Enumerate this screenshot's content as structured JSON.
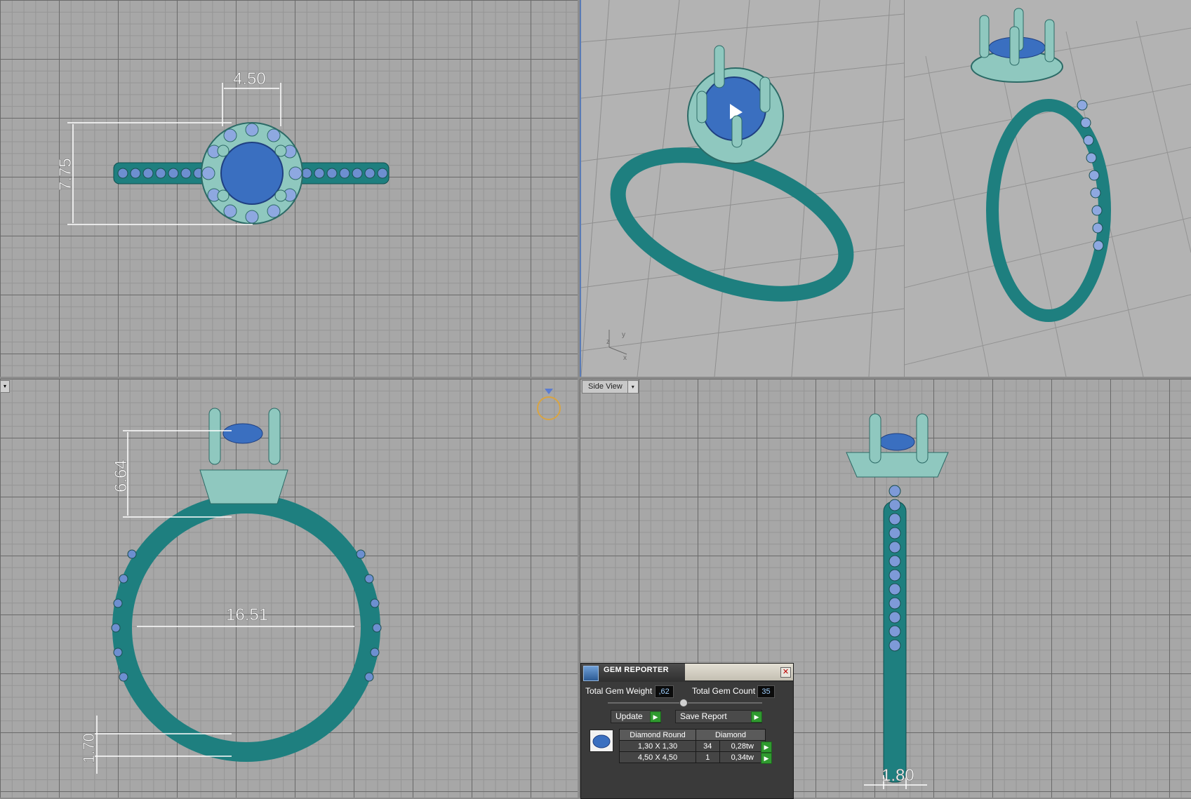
{
  "viewports": {
    "top": {
      "dim_width": "4.50",
      "dim_height": "7.75"
    },
    "front": {
      "dim_head": "6.64",
      "dim_inner": "16.51",
      "dim_shank": "1.70"
    },
    "side": {
      "label": "Side View",
      "dim_width": "1.80"
    }
  },
  "axes": {
    "x": "x",
    "y": "y",
    "z": "z"
  },
  "colors": {
    "metal": "#1e7f7f",
    "metal_light": "#8fc8bf",
    "stone": "#3a6fc0",
    "grid_bg": "#a7a7a7",
    "panel_bg": "#3a3a3a",
    "accent_green": "#2f9a2f"
  },
  "gem_reporter": {
    "title": "GEM REPORTER",
    "total_weight_label": "Total Gem Weight",
    "total_weight_value": ",62",
    "total_count_label": "Total Gem Count",
    "total_count_value": "35",
    "update_label": "Update",
    "save_label": "Save Report",
    "table": {
      "headers": [
        "Diamond Round",
        "Diamond"
      ],
      "rows": [
        {
          "size": "1,30 X 1,30",
          "count": "34",
          "weight": "0,28tw"
        },
        {
          "size": "4,50 X 4,50",
          "count": "1",
          "weight": "0,34tw"
        }
      ]
    }
  }
}
